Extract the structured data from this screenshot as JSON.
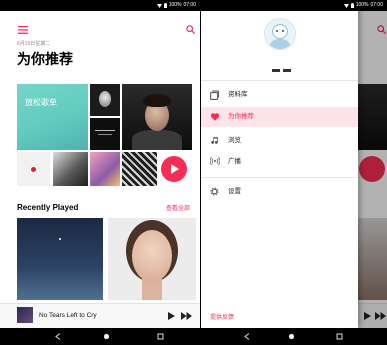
{
  "colors": {
    "accent": "#fa2d55",
    "selected_row_bg": "#fde4e8",
    "playlist_tile": "#62cbbf"
  },
  "status_bar": {
    "battery": "100%",
    "time": "07:00"
  },
  "for_you": {
    "date": "6月15日星期二",
    "title": "为你推荐",
    "featured_playlist": "放松歌单",
    "recently_played": {
      "heading": "Recently Played",
      "see_all": "查看全部"
    }
  },
  "now_playing": {
    "title": "No Tears Left to Cry"
  },
  "drawer": {
    "items": [
      {
        "label": "资料库",
        "icon": "library-icon",
        "selected": false
      },
      {
        "label": "为你推荐",
        "icon": "heart-icon",
        "selected": true
      },
      {
        "label": "浏览",
        "icon": "music-note-icon",
        "selected": false
      },
      {
        "label": "广播",
        "icon": "radio-icon",
        "selected": false
      },
      {
        "label": "设置",
        "icon": "gear-icon",
        "selected": false
      }
    ],
    "feedback": "提供反馈"
  }
}
